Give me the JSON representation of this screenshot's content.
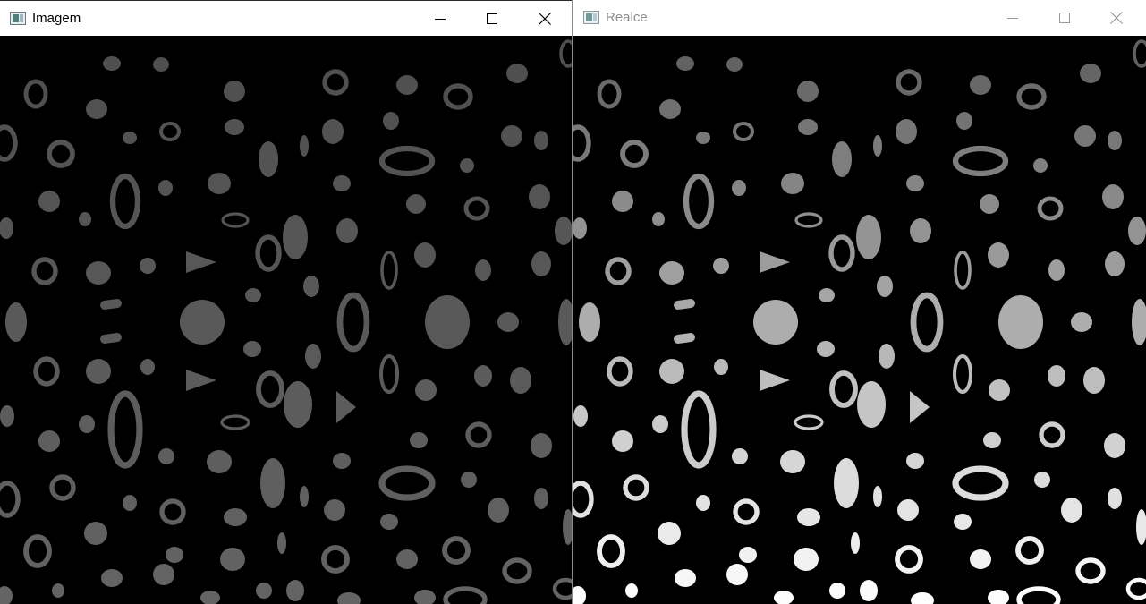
{
  "windows": {
    "left": {
      "title": "Imagem",
      "active": true
    },
    "right": {
      "title": "Realce",
      "active": false
    }
  },
  "icons": {
    "app": "opencv-window-icon",
    "minimize": "minimize-icon",
    "maximize": "maximize-icon",
    "close": "close-icon"
  },
  "colors": {
    "canvas_background": "#000000",
    "left_blob_mid": "#5a5a5a",
    "right_blob_mid": "#a0a0a0",
    "inactive_title_text": "#8c8c8c"
  }
}
